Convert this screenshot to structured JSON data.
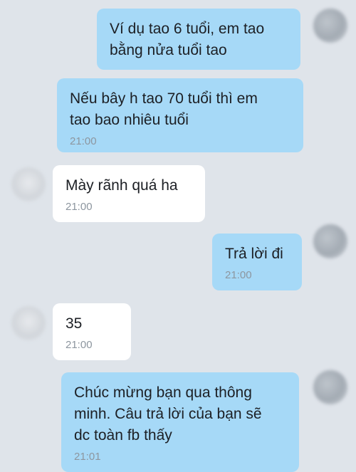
{
  "messages": [
    {
      "direction": "outgoing",
      "text": "Ví dụ tao 6 tuổi, em tao\nbằng nửa tuổi tao",
      "time": ""
    },
    {
      "direction": "outgoing",
      "text": "Nếu bây h tao 70 tuổi thì em\ntao bao nhiêu tuổi",
      "time": "21:00"
    },
    {
      "direction": "incoming",
      "text": "Mày rãnh quá ha",
      "time": "21:00"
    },
    {
      "direction": "outgoing",
      "text": "Trả lời đi",
      "time": "21:00"
    },
    {
      "direction": "incoming",
      "text": "35",
      "time": "21:00"
    },
    {
      "direction": "outgoing",
      "text": "Chúc mừng bạn qua thông\nminh. Câu trả lời của bạn sẽ\ndc toàn fb thấy",
      "time": "21:01"
    }
  ]
}
